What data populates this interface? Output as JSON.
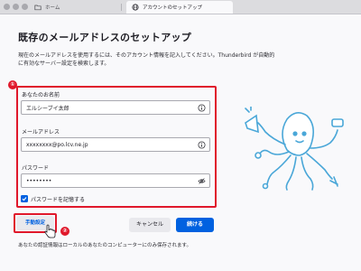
{
  "tabs": {
    "home_label": "ホーム",
    "active_label": "アカウントのセットアップ"
  },
  "page": {
    "title": "既存のメールアドレスのセットアップ",
    "description": "現在のメールアドレスを使用するには、そのアカウント情報を記入してください。Thunderbird が自動的に有効なサーバー設定を検索します。"
  },
  "annotations": {
    "badge_1": "①",
    "badge_2": "②"
  },
  "form": {
    "name_label": "あなたのお名前",
    "name_value": "エルシーブイ太郎",
    "email_label": "メールアドレス",
    "email_value": "xxxxxxxx@po.lcv.ne.jp",
    "password_label": "パスワード",
    "password_value": "••••••••",
    "remember_label": "パスワードを記憶する",
    "remember_checked": true
  },
  "buttons": {
    "manual": "手動設定",
    "cancel": "キャンセル",
    "continue": "続ける"
  },
  "footer": {
    "note": "あなたの認証情報はローカルのあなたのコンピューターにのみ保存されます。"
  },
  "colors": {
    "accent": "#0061e0",
    "annotation_red": "#e0182b",
    "mascot": "#4aa7d8"
  }
}
